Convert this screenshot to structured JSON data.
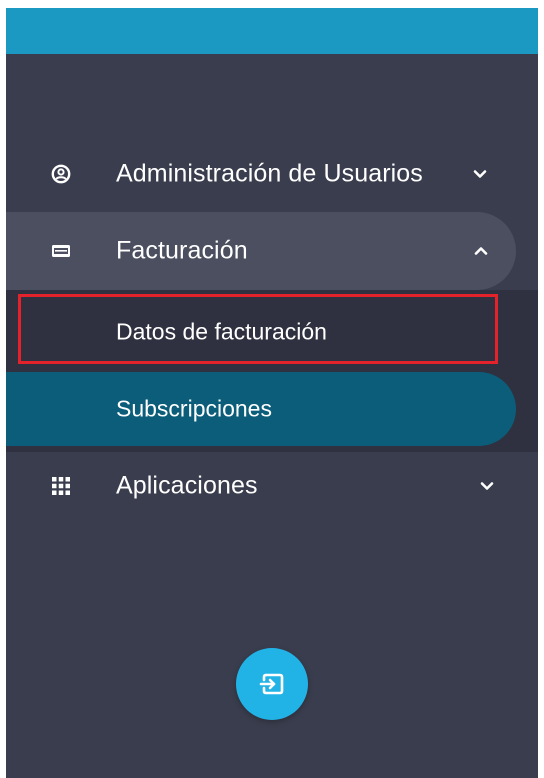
{
  "sidebar": {
    "items": [
      {
        "label": "Administración de Usuarios",
        "icon": "user-circle-icon",
        "chevron": "chevron-down-icon"
      },
      {
        "label": "Facturación",
        "icon": "billing-card-icon",
        "chevron": "chevron-up-icon"
      },
      {
        "label": "Aplicaciones",
        "icon": "apps-grid-icon",
        "chevron": "chevron-down-icon"
      }
    ],
    "billing_submenu": [
      {
        "label": "Datos de facturación"
      },
      {
        "label": "Subscripciones"
      }
    ],
    "logout_icon": "logout-icon"
  },
  "colors": {
    "topbar": "#1b99c2",
    "sidebar_bg": "#3a3d4d",
    "active_item_bg": "#4b4f5f",
    "submenu_bg": "#2f3140",
    "selected_subitem_bg": "#0b5d7a",
    "highlight_border": "#e3222b",
    "logout_button": "#22b3e6"
  }
}
